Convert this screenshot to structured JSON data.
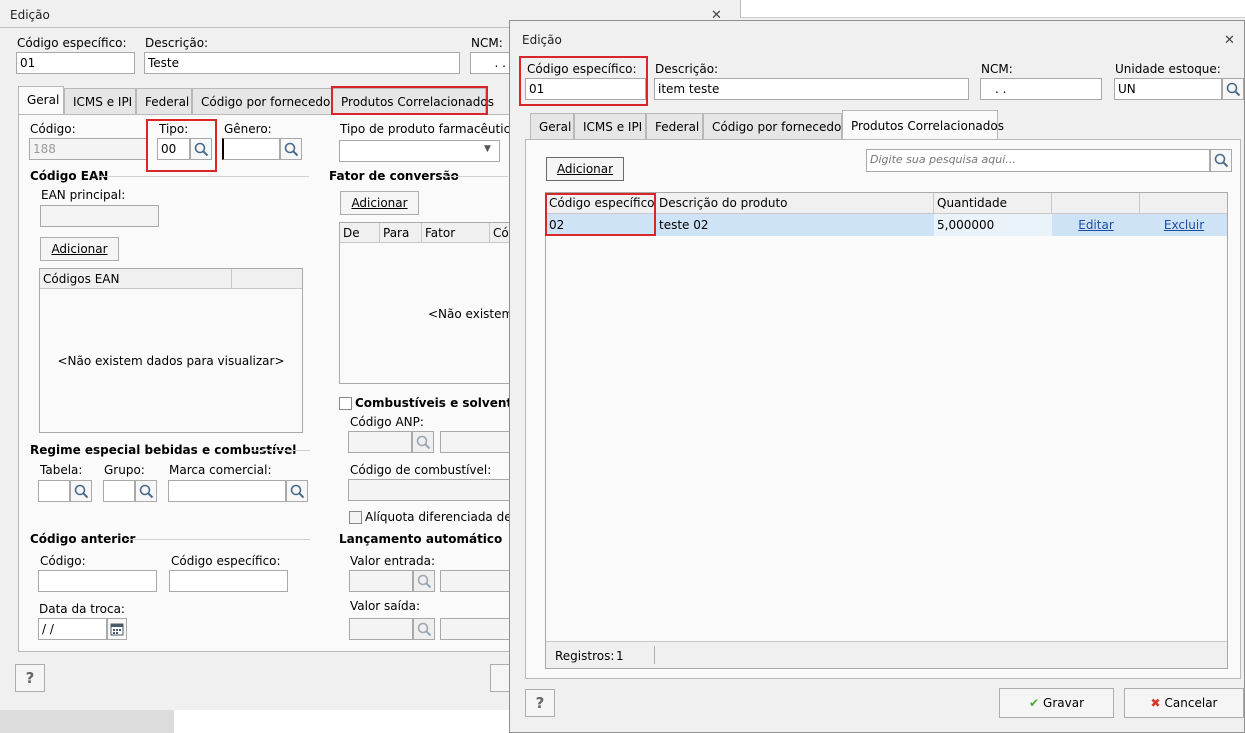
{
  "back_window": {
    "title": "Edição",
    "labels": {
      "codigo_especifico": "Código específico:",
      "descricao": "Descrição:",
      "ncm": "NCM:"
    },
    "values": {
      "codigo_especifico": "01",
      "descricao": "Teste",
      "ncm": ". ."
    },
    "tabs": [
      "Geral",
      "ICMS e IPI",
      "Federal",
      "Código por fornecedor",
      "Produtos Correlacionados"
    ],
    "geral": {
      "codigo_label": "Código:",
      "codigo_value": "188",
      "tipo_label": "Tipo:",
      "tipo_value": "00",
      "genero_label": "Gênero:",
      "tipo_farma_label": "Tipo de produto farmacêutico:",
      "codigo_ean_header": "Código EAN",
      "ean_principal_label": "EAN principal:",
      "adicionar": "Adicionar",
      "ean_grid_header": "Códigos EAN",
      "empty_text": "<Não existem dados para visualizar>",
      "fator_header": "Fator de conversão",
      "fator_adicionar": "Adicionar",
      "fator_cols": [
        "De",
        "Para",
        "Fator",
        "Có"
      ],
      "fator_empty": "<Não existem d",
      "combustiveis": "Combustíveis e solventes",
      "codigo_anp": "Código ANP:",
      "codigo_combustivel": "Código de combustível:",
      "aliquota": "Alíquota diferenciada de IR",
      "regime_header": "Regime especial bebidas e combustível",
      "tabela": "Tabela:",
      "grupo": "Grupo:",
      "marca": "Marca comercial:",
      "lancamento_header": "Lançamento automático",
      "valor_entrada": "Valor entrada:",
      "valor_saida": "Valor saída:",
      "codigo_anterior_header": "Código anterior",
      "ca_codigo": "Código:",
      "ca_codigo_especifico": "Código específico:",
      "data_troca": "Data da troca:",
      "data_value": " / /"
    },
    "help": "?"
  },
  "front_window": {
    "title": "Edição",
    "labels": {
      "codigo_especifico": "Código específico:",
      "descricao": "Descrição:",
      "ncm": "NCM:",
      "unidade": "Unidade estoque:"
    },
    "values": {
      "codigo_especifico": "01",
      "descricao": "item teste",
      "ncm": ". .",
      "unidade": "UN"
    },
    "tabs": [
      "Geral",
      "ICMS e IPI",
      "Federal",
      "Código por fornecedor",
      "Produtos Correlacionados"
    ],
    "adicionar": "Adicionar",
    "search_placeholder": "Digite sua pesquisa aqui...",
    "table": {
      "columns": [
        "Código específico",
        "Descrição do produto",
        "Quantidade",
        "",
        ""
      ],
      "rows": [
        {
          "codigo": "02",
          "descricao": "teste 02",
          "quantidade": "5,000000",
          "editar": "Editar",
          "excluir": "Excluir"
        }
      ]
    },
    "registros_label": "Registros:",
    "registros_value": "1",
    "help": "?",
    "gravar": "Gravar",
    "cancelar": "Cancelar"
  },
  "colors": {
    "highlight_red": "#d9262b",
    "selected_row": "#cfe3f6",
    "link_blue": "#1a4ea0"
  }
}
